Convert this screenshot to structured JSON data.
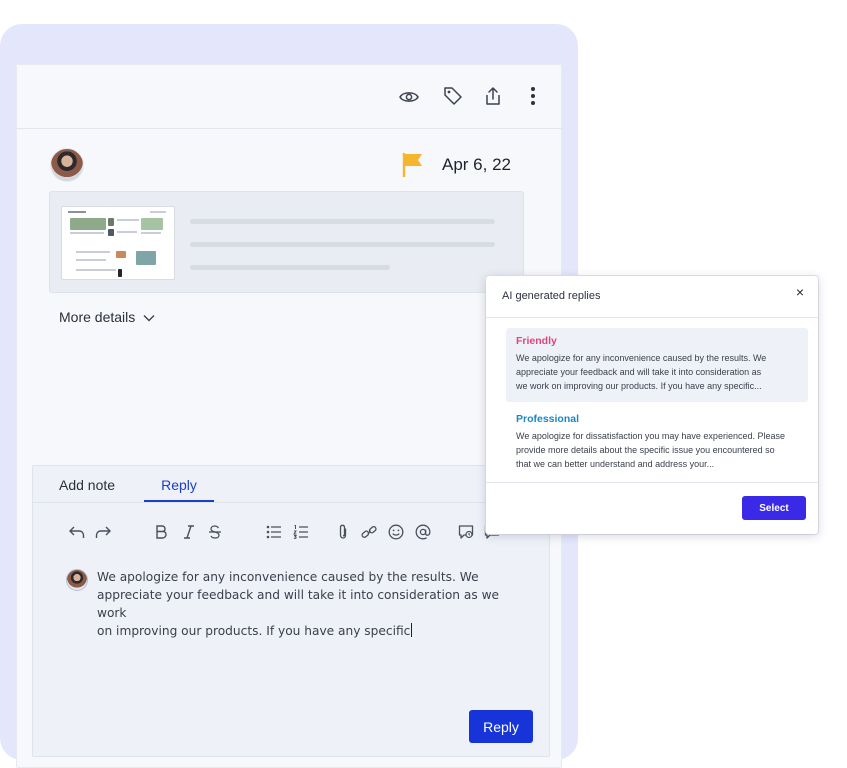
{
  "header": {
    "icons": [
      "eye-icon",
      "tag-icon",
      "share-icon",
      "more-vertical-icon"
    ],
    "flag_color": "#f5b52e",
    "date": "Apr 6, 22"
  },
  "preview": {
    "more_details_label": "More details"
  },
  "composer": {
    "tabs": [
      {
        "label": "Add note",
        "active": false
      },
      {
        "label": "Reply",
        "active": true
      }
    ],
    "format_icons": [
      "undo-icon",
      "redo-icon",
      "bold-icon",
      "italic-icon",
      "strikethrough-icon",
      "bullet-list-icon",
      "numbered-list-icon",
      "attachment-icon",
      "link-icon",
      "emoji-icon",
      "mention-icon",
      "canned-response-icon",
      "ai-reply-icon"
    ],
    "draft_lines": [
      "We apologize for any inconvenience caused by the results. We",
      "appreciate your feedback and will take it into consideration as we work",
      "on improving our products. If you have any specific"
    ],
    "reply_button": "Reply",
    "accent_color": "#1634d8"
  },
  "ai_popup": {
    "title": "AI generated replies",
    "close_label": "×",
    "options": [
      {
        "title": "Friendly",
        "color": "#e0457b",
        "selected": true,
        "lines": [
          "We apologize for any inconvenience caused by the results. We",
          "appreciate your feedback and will take it into consideration as",
          "we work on improving our products. If you have any specific..."
        ]
      },
      {
        "title": "Professional",
        "color": "#1a87c4",
        "selected": false,
        "lines": [
          "We apologize for dissatisfaction you may have experienced. Please",
          "provide more details about the specific issue you encountered so",
          "that we can better understand and address your..."
        ]
      }
    ],
    "select_button": "Select"
  }
}
